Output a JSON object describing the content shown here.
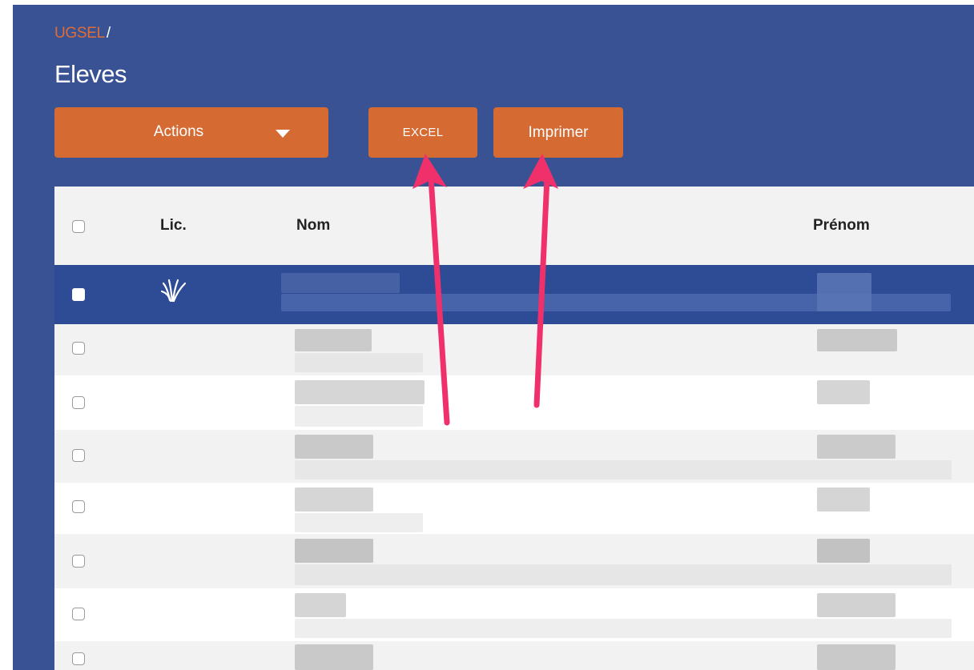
{
  "breadcrumb": {
    "root": "UGSEL",
    "separator": "/"
  },
  "page": {
    "title": "Eleves"
  },
  "toolbar": {
    "actions_label": "Actions",
    "excel_label": "EXCEL",
    "print_label": "Imprimer"
  },
  "table": {
    "columns": {
      "lic": "Lic.",
      "nom": "Nom",
      "prenom": "Prénom"
    }
  },
  "icons": {
    "dropdown": "chevron-down-icon",
    "license": "ugsel-license-icon",
    "annotation": "arrow-icon"
  },
  "colors": {
    "background_blue": "#385294",
    "accent_orange": "#d56a33",
    "selected_row": "#2e4c96",
    "arrow_pink": "#f0306b"
  }
}
